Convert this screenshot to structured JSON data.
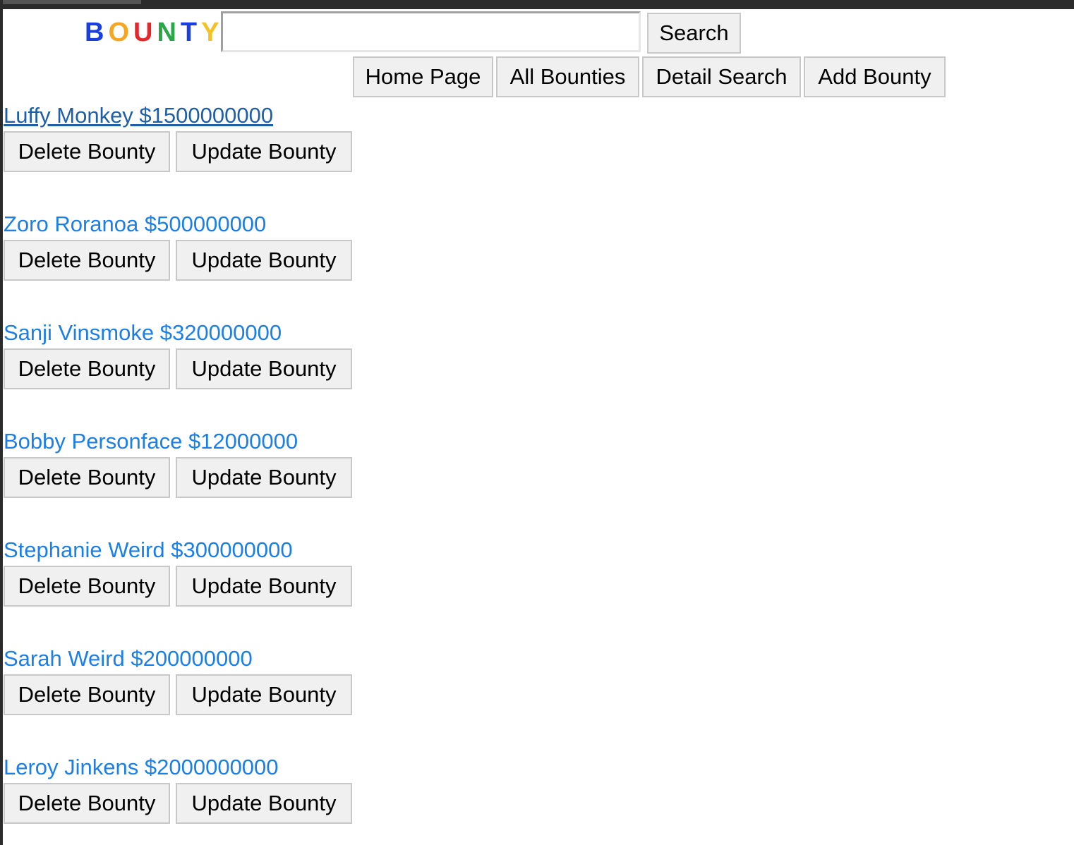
{
  "header": {
    "logo_letters": [
      {
        "char": "B",
        "color": "#1a3fe0"
      },
      {
        "char": "O",
        "color": "#f5a623"
      },
      {
        "char": "U",
        "color": "#e8262a"
      },
      {
        "char": "N",
        "color": "#27a745"
      },
      {
        "char": "T",
        "color": "#1a3fe0"
      },
      {
        "char": "Y",
        "color": "#f5c123"
      }
    ],
    "search_value": "",
    "search_button_label": "Search"
  },
  "nav": {
    "home_label": "Home Page",
    "all_label": "All Bounties",
    "detail_label": "Detail Search",
    "add_label": "Add Bounty"
  },
  "bounties": [
    {
      "label": "Luffy Monkey $1500000000",
      "delete_label": "Delete Bounty",
      "update_label": "Update Bounty"
    },
    {
      "label": "Zoro Roranoa $500000000",
      "delete_label": "Delete Bounty",
      "update_label": "Update Bounty"
    },
    {
      "label": "Sanji Vinsmoke $320000000",
      "delete_label": "Delete Bounty",
      "update_label": "Update Bounty"
    },
    {
      "label": "Bobby Personface $12000000",
      "delete_label": "Delete Bounty",
      "update_label": "Update Bounty"
    },
    {
      "label": "Stephanie Weird $300000000",
      "delete_label": "Delete Bounty",
      "update_label": "Update Bounty"
    },
    {
      "label": "Sarah Weird $200000000",
      "delete_label": "Delete Bounty",
      "update_label": "Update Bounty"
    },
    {
      "label": "Leroy Jinkens $2000000000",
      "delete_label": "Delete Bounty",
      "update_label": "Update Bounty"
    }
  ],
  "colors": {
    "link": "#1a7fe8",
    "link_visited": "#1f5fa8",
    "button_bg": "#f0f0f0"
  }
}
